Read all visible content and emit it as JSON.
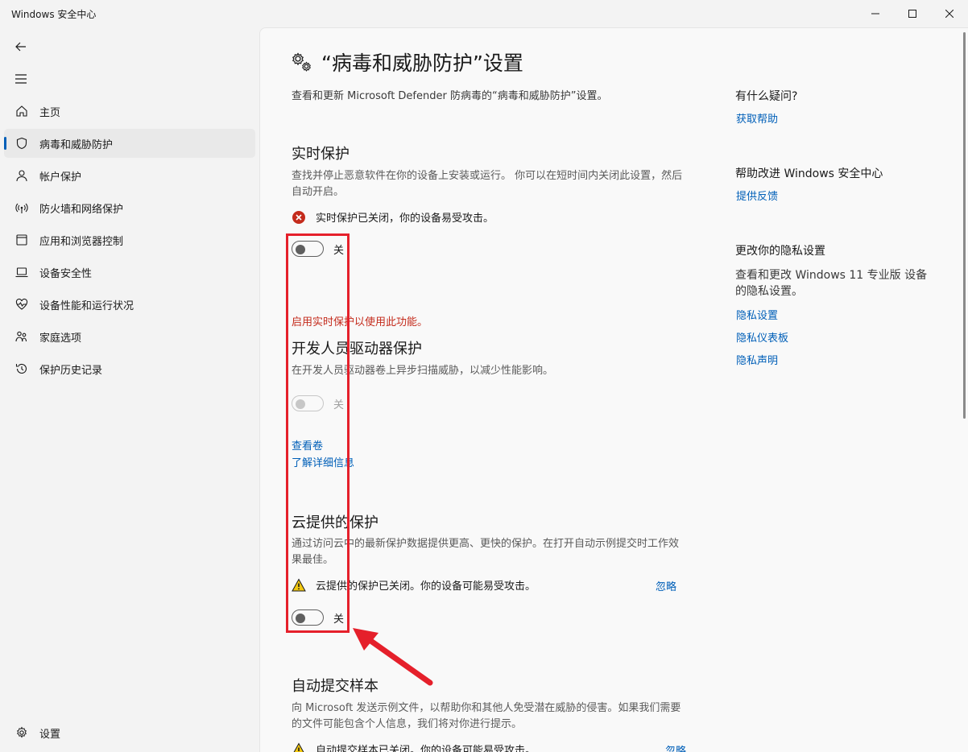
{
  "window": {
    "title": "Windows 安全中心",
    "minimize": "—",
    "maximize": "☐",
    "close": "✕"
  },
  "sidebar": {
    "items": [
      {
        "label": "主页",
        "icon": "home-icon"
      },
      {
        "label": "病毒和威胁防护",
        "icon": "shield-icon",
        "active": true
      },
      {
        "label": "帐户保护",
        "icon": "person-icon"
      },
      {
        "label": "防火墙和网络保护",
        "icon": "wireless-icon"
      },
      {
        "label": "应用和浏览器控制",
        "icon": "app-window-icon"
      },
      {
        "label": "设备安全性",
        "icon": "laptop-icon"
      },
      {
        "label": "设备性能和运行状况",
        "icon": "heartbeat-icon"
      },
      {
        "label": "家庭选项",
        "icon": "family-icon"
      },
      {
        "label": "保护历史记录",
        "icon": "history-icon"
      }
    ],
    "settings": "设置"
  },
  "page": {
    "title": "“病毒和威胁防护”设置",
    "description": "查看和更新 Microsoft Defender 防病毒的“病毒和威胁防护”设置。"
  },
  "realtime": {
    "title": "实时保护",
    "description": "查找并停止恶意软件在你的设备上安装或运行。 你可以在短时间内关闭此设置，然后自动开启。",
    "status": "实时保护已关闭，你的设备易受攻击。",
    "toggle_label": "关"
  },
  "dev_drive": {
    "warning": "启用实时保护以使用此功能。",
    "title": "开发人员驱动器保护",
    "description": "在开发人员驱动器卷上异步扫描威胁，以减少性能影响。",
    "toggle_label": "关",
    "link_view": "查看卷",
    "link_learn": "了解详细信息"
  },
  "cloud": {
    "title": "云提供的保护",
    "description": "通过访问云中的最新保护数据提供更高、更快的保护。在打开自动示例提交时工作效果最佳。",
    "status": "云提供的保护已关闭。你的设备可能易受攻击。",
    "dismiss": "忽略",
    "toggle_label": "关"
  },
  "sample": {
    "title": "自动提交样本",
    "description": "向 Microsoft 发送示例文件，以帮助你和其他人免受潜在威胁的侵害。如果我们需要的文件可能包含个人信息，我们将对你进行提示。",
    "status": "自动提交样本已关闭。你的设备可能易受攻击。",
    "dismiss": "忽略"
  },
  "right": {
    "question": "有什么疑问?",
    "get_help": "获取帮助",
    "improve": "帮助改进 Windows 安全中心",
    "feedback": "提供反馈",
    "privacy_title": "更改你的隐私设置",
    "privacy_desc": "查看和更改 Windows 11 专业版 设备的隐私设置。",
    "privacy_settings": "隐私设置",
    "privacy_dashboard": "隐私仪表板",
    "privacy_statement": "隐私声明"
  },
  "colors": {
    "accent": "#005fb8",
    "error": "#c42b1c",
    "warning": "#f2c811",
    "annotation": "#e5202b"
  }
}
